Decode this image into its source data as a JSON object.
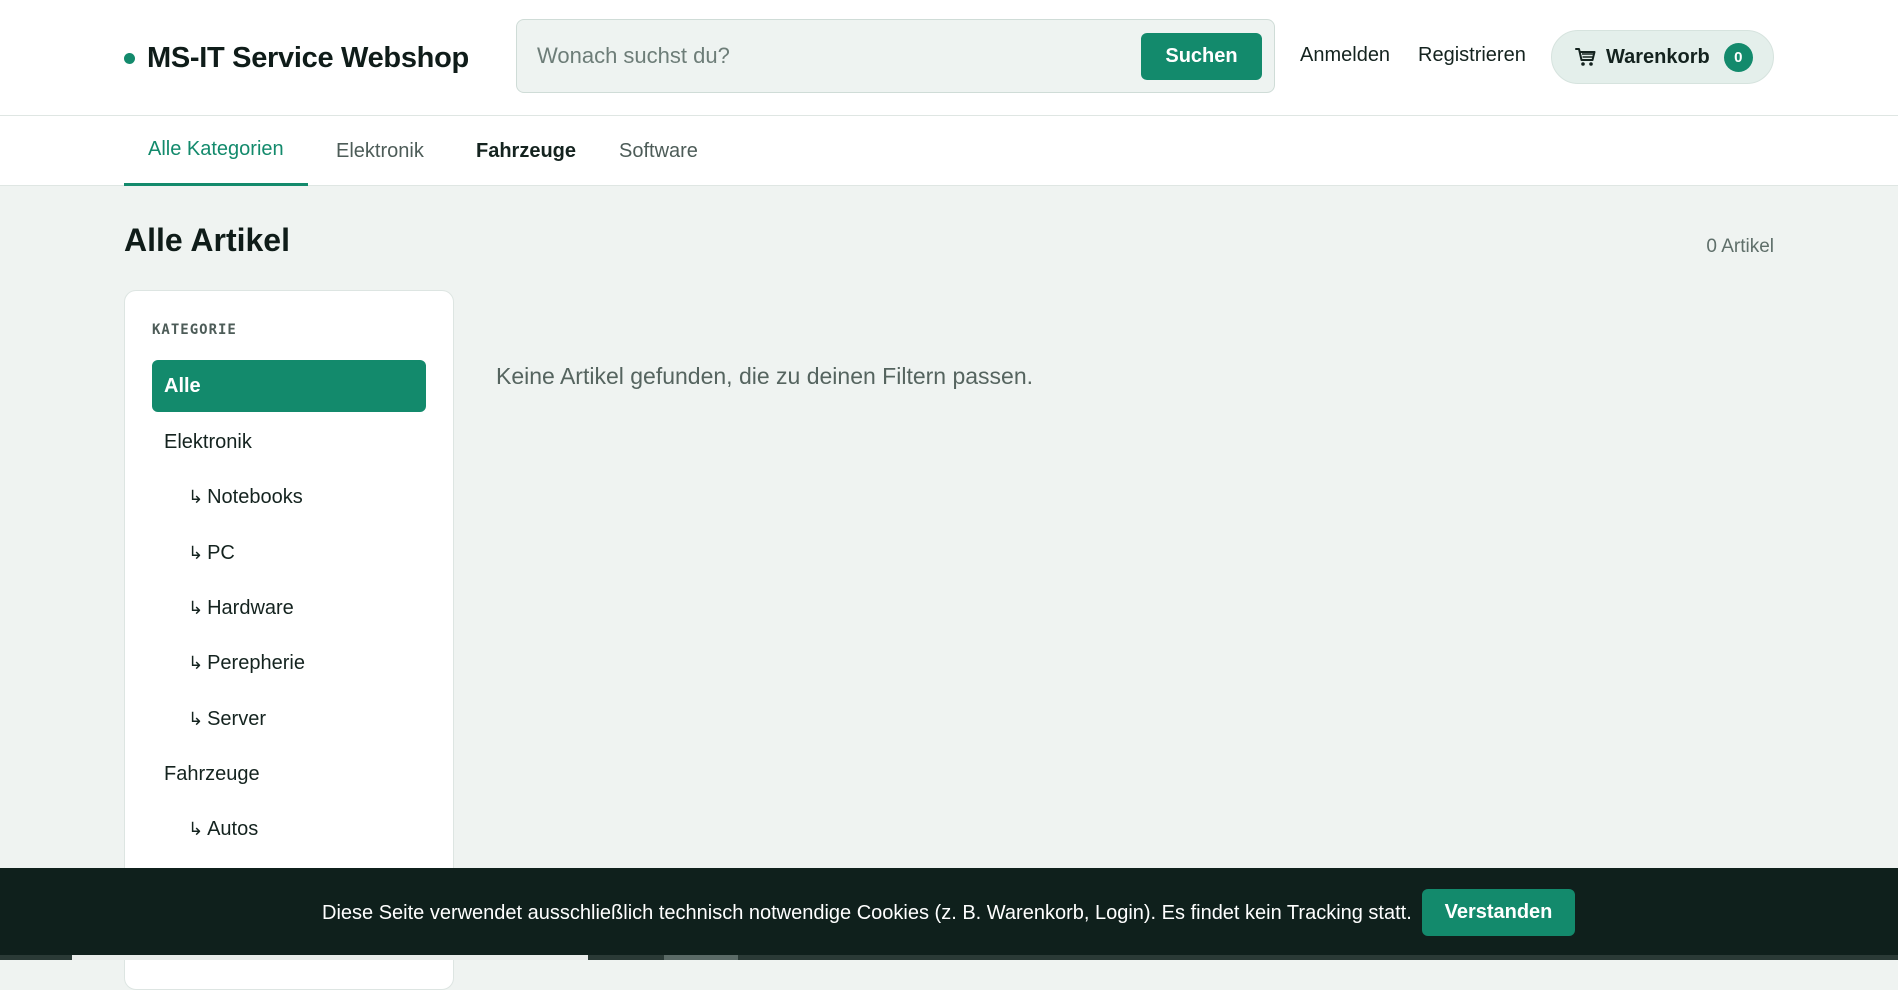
{
  "header": {
    "brand": "MS-IT Service Webshop",
    "search_placeholder": "Wonach suchst du?",
    "search_button": "Suchen",
    "login": "Anmelden",
    "register": "Registrieren",
    "cart_label": "Warenkorb",
    "cart_count": "0"
  },
  "nav": {
    "tabs": [
      {
        "label": "Alle Kategorien",
        "active": true
      },
      {
        "label": "Elektronik"
      },
      {
        "label": "Fahrzeuge"
      },
      {
        "label": "Software"
      }
    ]
  },
  "main": {
    "title": "Alle Artikel",
    "count": "0 Artikel",
    "empty_message": "Keine Artikel gefunden, die zu deinen Filtern passen."
  },
  "sidebar": {
    "heading": "KATEGORIE",
    "items": [
      {
        "label": "Alle",
        "active": true
      },
      {
        "label": "Elektronik"
      },
      {
        "label": "Notebooks",
        "sub": true
      },
      {
        "label": "PC",
        "sub": true
      },
      {
        "label": "Hardware",
        "sub": true
      },
      {
        "label": "Perepherie",
        "sub": true
      },
      {
        "label": "Server",
        "sub": true
      },
      {
        "label": "Fahrzeuge"
      },
      {
        "label": "Autos",
        "sub": true
      }
    ],
    "sub_arrow": "↳"
  },
  "cookie": {
    "text": "Diese Seite verwendet ausschließlich technisch notwendige Cookies (z. B. Warenkorb, Login). Es findet kein Tracking statt.",
    "button": "Verstanden"
  },
  "colors": {
    "accent": "#138a6c",
    "dark": "#0f201c",
    "background": "#eff3f1"
  }
}
